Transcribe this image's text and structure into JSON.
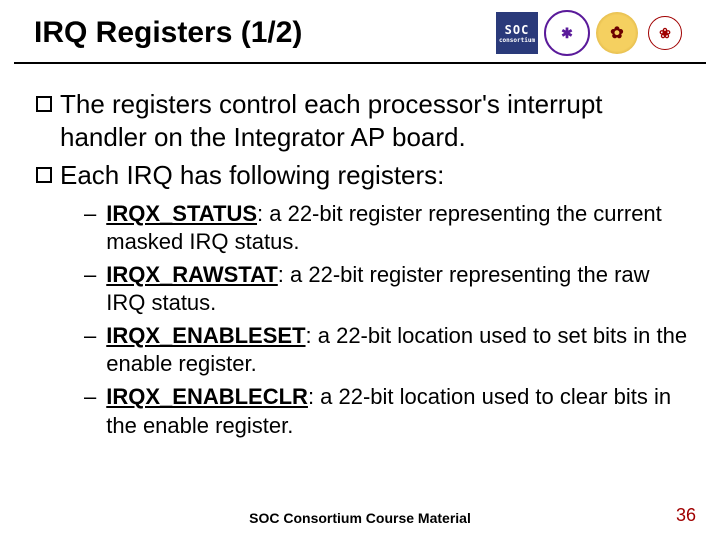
{
  "header": {
    "title": "IRQ Registers (1/2)",
    "logos": {
      "soc_big": "SOC",
      "soc_small": "consortium",
      "purple": "✱",
      "yellow": "✿",
      "red": "❀"
    }
  },
  "bullets": [
    "The registers control each processor's interrupt handler on the Integrator AP board.",
    "Each IRQ has following registers:"
  ],
  "registers": [
    {
      "name": "IRQX_STATUS",
      "desc": ": a 22-bit register representing the current masked IRQ status."
    },
    {
      "name": "IRQX_RAWSTAT",
      "desc": ": a 22-bit register representing the raw IRQ status."
    },
    {
      "name": "IRQX_ENABLESET",
      "desc": ": a 22-bit location used to set bits in the enable register."
    },
    {
      "name": "IRQX_ENABLECLR",
      "desc": ": a 22-bit location used to clear bits in the enable register."
    }
  ],
  "footer": "SOC Consortium Course Material",
  "page": "36"
}
